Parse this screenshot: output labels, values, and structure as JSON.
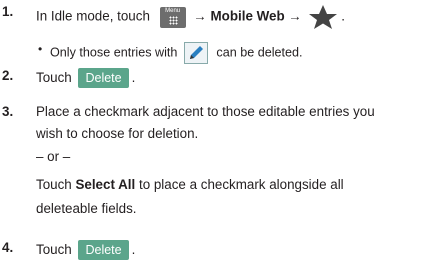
{
  "steps": [
    {
      "num": "1.",
      "text_a": "In Idle mode, touch",
      "arrow1": "→",
      "mobile_web": "Mobile Web",
      "arrow2": "→",
      "end": "."
    },
    {
      "num": "2.",
      "text": "Touch",
      "button": "Delete",
      "end": "."
    },
    {
      "num": "3.",
      "line1": "Place a checkmark adjacent to those editable entries you",
      "line2": "wish to choose for deletion.",
      "or": "– or –",
      "line3a": "Touch ",
      "select_all": "Select All",
      "line3b": " to place a checkmark alongside all",
      "line4": "deleteable fields."
    },
    {
      "num": "4.",
      "text": "Touch",
      "button": "Delete",
      "end": "."
    }
  ],
  "bullet": {
    "mark": "•",
    "text_a": "Only those entries with",
    "text_b": "can be deleted."
  },
  "menu_key_label": "Menu",
  "icons": [
    "menu-key-icon",
    "bookmark-star-icon",
    "edit-pencil-icon"
  ],
  "colors": {
    "button": "#5ba58b",
    "menu_key": "#6d6d6d",
    "text": "#231f20"
  }
}
